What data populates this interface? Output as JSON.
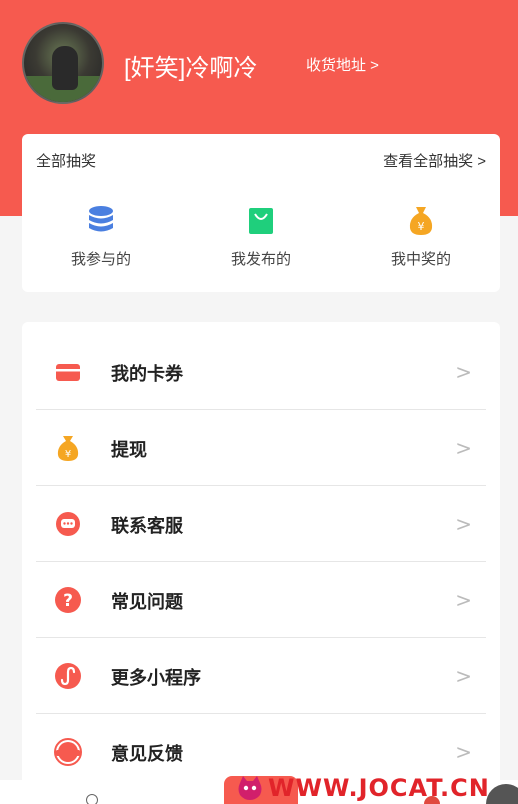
{
  "header": {
    "username": "[奸笑]冷啊冷",
    "address_link": "收货地址 >"
  },
  "lottery": {
    "title": "全部抽奖",
    "view_all": "查看全部抽奖 >",
    "items": [
      {
        "label": "我参与的",
        "icon": "coin-stack-icon"
      },
      {
        "label": "我发布的",
        "icon": "shopping-bag-icon"
      },
      {
        "label": "我中奖的",
        "icon": "money-bag-icon"
      }
    ]
  },
  "menu": {
    "items": [
      {
        "label": "我的卡券",
        "icon": "card-icon"
      },
      {
        "label": "提现",
        "icon": "money-bag-icon"
      },
      {
        "label": "联系客服",
        "icon": "chat-bubble-icon"
      },
      {
        "label": "常见问题",
        "icon": "question-icon"
      },
      {
        "label": "更多小程序",
        "icon": "mini-program-icon"
      },
      {
        "label": "意见反馈",
        "icon": "feedback-icon"
      }
    ],
    "chevron": ">"
  },
  "watermark": {
    "text": "WWW.JOCAT.CN"
  },
  "colors": {
    "brand": "#f65a4f",
    "blue": "#4a7fe0",
    "green": "#1fcf7c",
    "orange": "#f5a623"
  }
}
